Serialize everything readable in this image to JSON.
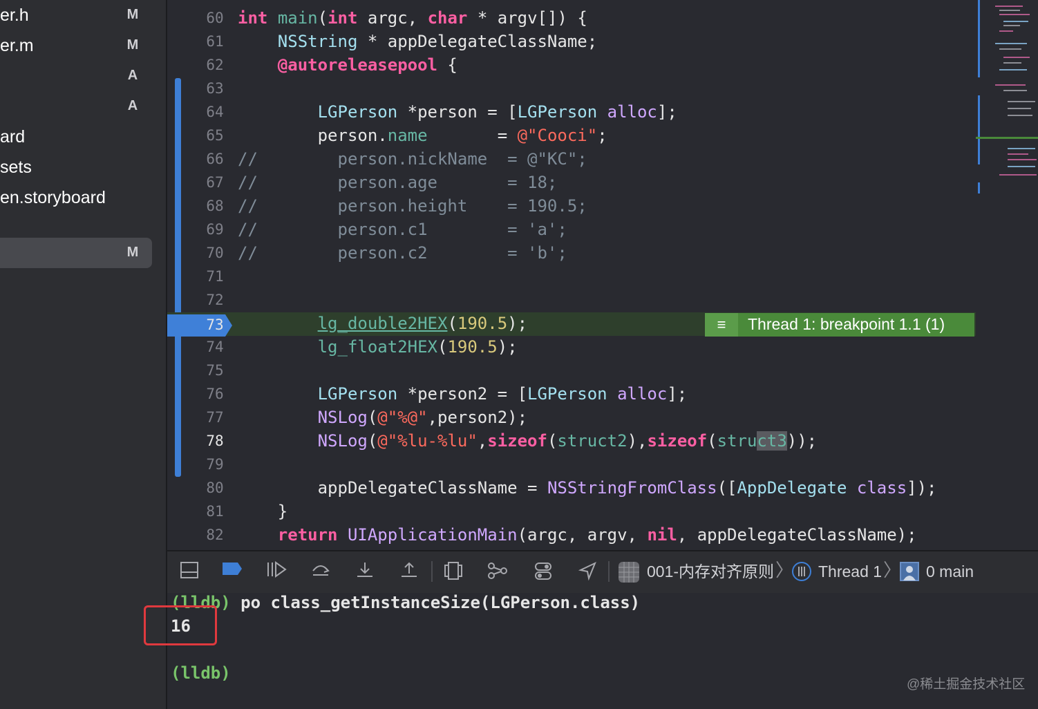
{
  "navigator": {
    "items": [
      {
        "name": "er.h",
        "badge": "M"
      },
      {
        "name": "er.m",
        "badge": "M"
      },
      {
        "name": "",
        "badge": "A"
      },
      {
        "name": "",
        "badge": "A"
      },
      {
        "name": "ard",
        "badge": ""
      },
      {
        "name": "sets",
        "badge": ""
      },
      {
        "name": "en.storyboard",
        "badge": ""
      },
      {
        "name": "",
        "badge": ""
      },
      {
        "name": "",
        "badge": "M"
      }
    ]
  },
  "editor": {
    "line_numbers": [
      "60",
      "61",
      "62",
      "63",
      "64",
      "65",
      "66",
      "67",
      "68",
      "69",
      "70",
      "71",
      "72",
      "73",
      "74",
      "75",
      "76",
      "77",
      "78",
      "79",
      "80",
      "81",
      "82"
    ],
    "current_line": "73",
    "breakpoint": {
      "menu_glyph": "≡",
      "text": "Thread 1: breakpoint 1.1 (1)"
    },
    "tokens": {
      "l60": [
        "int",
        " ",
        "main",
        "(",
        "int",
        " argc, ",
        "char",
        " * argv[]) {"
      ],
      "l61": [
        "    ",
        "NSString",
        " * appDelegateClassName;"
      ],
      "l62": [
        "    ",
        "@autoreleasepool",
        " {"
      ],
      "l64": [
        "        ",
        "LGPerson",
        " *person = [",
        "LGPerson",
        " ",
        "alloc",
        "];"
      ],
      "l65": [
        "        person.",
        "name",
        "       = ",
        "@\"Cooci\"",
        ";"
      ],
      "l66": "//        person.nickName  = @\"KC\";",
      "l67": "//        person.age       = 18;",
      "l68": "//        person.height    = 190.5;",
      "l69": "//        person.c1        = 'a';",
      "l70": "//        person.c2        = 'b';",
      "l73": [
        "        ",
        "lg_double2HEX",
        "(",
        "190.5",
        ");"
      ],
      "l74": [
        "        ",
        "lg_float2HEX",
        "(",
        "190.5",
        ");"
      ],
      "l76": [
        "        ",
        "LGPerson",
        " *person2 = [",
        "LGPerson",
        " ",
        "alloc",
        "];"
      ],
      "l77": [
        "        ",
        "NSLog",
        "(",
        "@\"%@\"",
        ",person2);"
      ],
      "l78": [
        "        ",
        "NSLog",
        "(",
        "@\"%lu-%lu\"",
        ",",
        "sizeof",
        "(",
        "struct2",
        "),",
        "sizeof",
        "(",
        "stru",
        "ct3",
        "));"
      ],
      "l80": [
        "        appDelegateClassName = ",
        "NSStringFromClass",
        "([",
        "AppDelegate",
        " ",
        "class",
        "]);"
      ],
      "l81": "    }",
      "l82": [
        "    ",
        "return",
        " ",
        "UIApplicationMain",
        "(argc, argv, ",
        "nil",
        ", appDelegateClassName);"
      ]
    }
  },
  "debug_bar": {
    "target": "001-内存对齐原则",
    "thread": "Thread 1",
    "frame": "0 main",
    "chevron": "〉"
  },
  "console": {
    "prompt": "(lldb)",
    "command": " po class_getInstanceSize(LGPerson.class)",
    "result": "16"
  },
  "watermark": "@稀土掘金技术社区",
  "colors": {
    "keyword": "#fc5fa3",
    "string": "#fc6a5d",
    "number": "#d9c97c",
    "breakpoint_green": "#4a8a3a",
    "gutter_blue": "#3e7fd6",
    "highlight_red": "#e0393e"
  }
}
